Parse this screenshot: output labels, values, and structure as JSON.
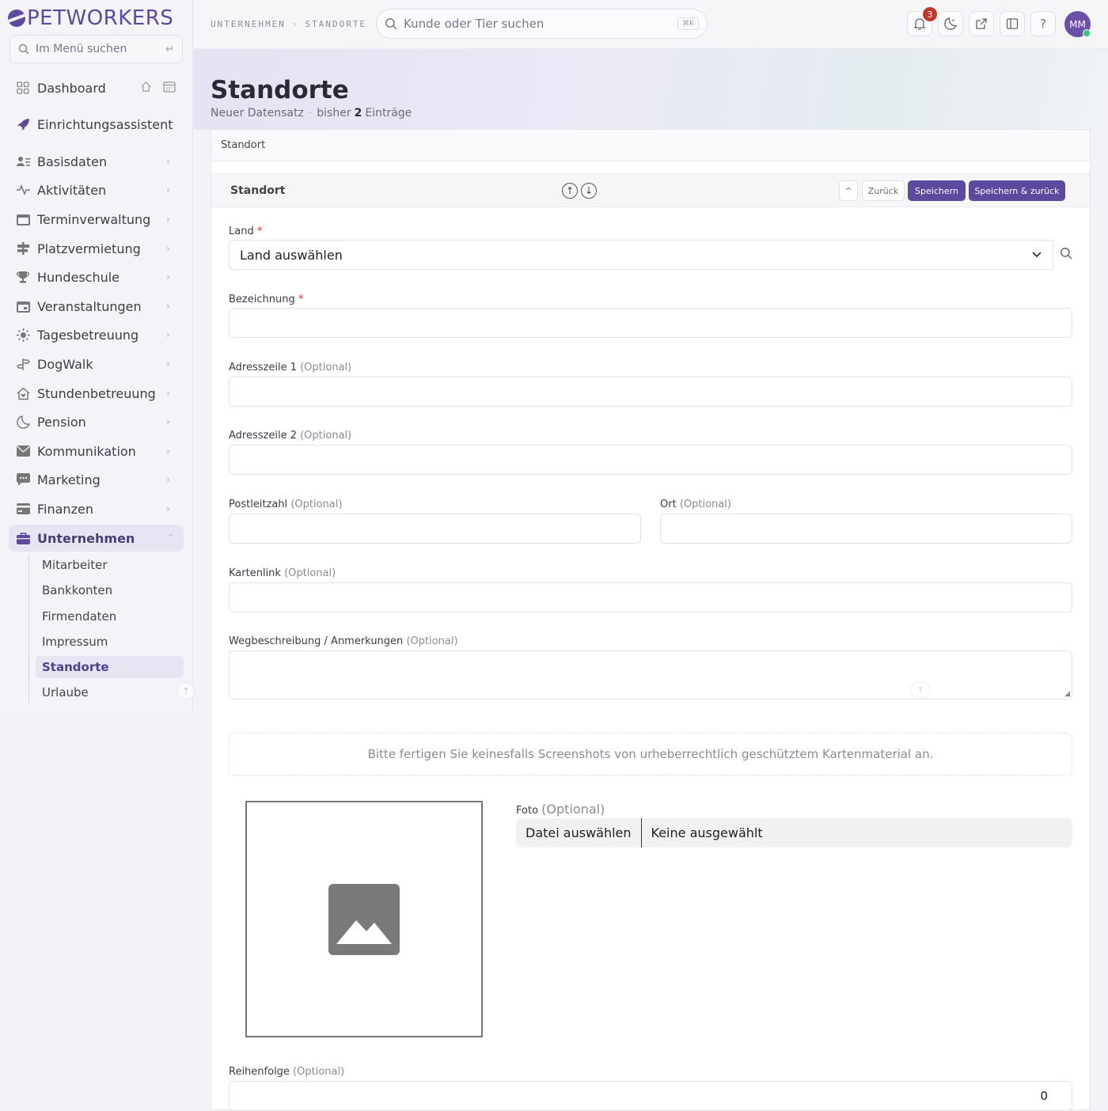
{
  "brand": {
    "name": "PETWORKERS"
  },
  "menu_search": {
    "placeholder": "Im Menü suchen"
  },
  "nav": {
    "dashboard": "Dashboard",
    "wizard": "Einrichtungsassistent",
    "items": [
      "Basisdaten",
      "Aktivitäten",
      "Terminverwaltung",
      "Platzvermietung",
      "Hundeschule",
      "Veranstaltungen",
      "Tagesbetreuung",
      "DogWalk",
      "Stundenbetreuung",
      "Pension",
      "Kommunikation",
      "Marketing",
      "Finanzen",
      "Unternehmen"
    ],
    "sub": [
      "Mitarbeiter",
      "Bankkonten",
      "Firmendaten",
      "Impressum",
      "Standorte",
      "Urlaube"
    ]
  },
  "breadcrumb": [
    "UNTERNEHMEN",
    "STANDORTE"
  ],
  "global_search": {
    "placeholder": "Kunde oder Tier suchen",
    "shortcut": "⌘K"
  },
  "notifications_count": "3",
  "user_initials": "MM",
  "page": {
    "title": "Standorte",
    "subtitle_left": "Neuer Datensatz",
    "subtitle_sep": "·",
    "subtitle_pre": "bisher",
    "count": "2",
    "subtitle_post": "Einträge"
  },
  "tab": "Standort",
  "section": {
    "title": "Standort",
    "back": "Zurück",
    "save": "Speichern",
    "save_back": "Speichern & zurück"
  },
  "form": {
    "land_label": "Land",
    "land_value": "Land auswählen",
    "bezeichnung_label": "Bezeichnung",
    "adresse1_label": "Adresszeile 1",
    "adresse2_label": "Adresszeile 2",
    "plz_label": "Postleitzahl",
    "ort_label": "Ort",
    "karte_label": "Kartenlink",
    "weg_label": "Wegbeschreibung / Anmerkungen",
    "optional": "(Optional)",
    "notice": "Bitte fertigen Sie keinesfalls Screenshots von urheberrechtlich geschütztem Kartenmaterial an.",
    "foto_label": "Foto",
    "file_button": "Datei auswählen",
    "file_value": "Keine ausgewählt",
    "reihenfolge_label": "Reihenfolge",
    "reihenfolge_value": "0"
  },
  "colors": {
    "accent": "#5b4a9e",
    "required": "#dd3333",
    "badge": "#c0392b"
  }
}
